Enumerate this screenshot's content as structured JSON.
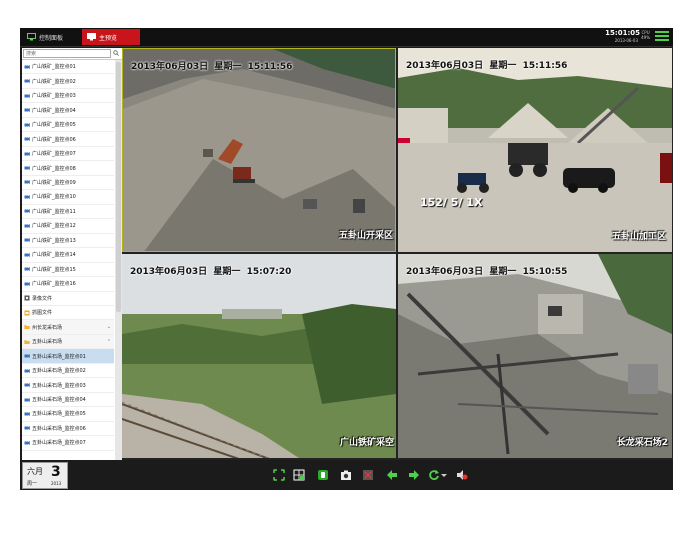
{
  "topbar": {
    "tab_control": "控制面板",
    "tab_preview": "主预览",
    "clock_time": "15:01:05",
    "clock_date": "2013-06-03",
    "cpu_label": "CPU",
    "cpu_value": "49%"
  },
  "sidebar": {
    "search_placeholder": "搜索",
    "items": [
      {
        "label": "广山铁矿_监控点01",
        "kind": "camera"
      },
      {
        "label": "广山铁矿_监控点02",
        "kind": "camera"
      },
      {
        "label": "广山铁矿_监控点03",
        "kind": "camera"
      },
      {
        "label": "广山铁矿_监控点04",
        "kind": "camera"
      },
      {
        "label": "广山铁矿_监控点05",
        "kind": "camera"
      },
      {
        "label": "广山铁矿_监控点06",
        "kind": "camera"
      },
      {
        "label": "广山铁矿_监控点07",
        "kind": "camera"
      },
      {
        "label": "广山铁矿_监控点08",
        "kind": "camera"
      },
      {
        "label": "广山铁矿_监控点09",
        "kind": "camera"
      },
      {
        "label": "广山铁矿_监控点10",
        "kind": "camera"
      },
      {
        "label": "广山铁矿_监控点11",
        "kind": "camera"
      },
      {
        "label": "广山铁矿_监控点12",
        "kind": "camera"
      },
      {
        "label": "广山铁矿_监控点13",
        "kind": "camera"
      },
      {
        "label": "广山铁矿_监控点14",
        "kind": "camera"
      },
      {
        "label": "广山铁矿_监控点15",
        "kind": "camera"
      },
      {
        "label": "广山铁矿_监控点16",
        "kind": "camera"
      },
      {
        "label": "录像文件",
        "kind": "file"
      },
      {
        "label": "抓图文件",
        "kind": "image"
      },
      {
        "label": "州长龙采石场",
        "kind": "group",
        "chev": "⌄"
      },
      {
        "label": "五卦山采石场",
        "kind": "group",
        "chev": "⌃"
      },
      {
        "label": "五卦山采石场_监控点01",
        "kind": "camera",
        "selected": true
      },
      {
        "label": "五卦山采石场_监控点02",
        "kind": "camera"
      },
      {
        "label": "五卦山采石场_监控点03",
        "kind": "camera"
      },
      {
        "label": "五卦山采石场_监控点04",
        "kind": "camera"
      },
      {
        "label": "五卦山采石场_监控点05",
        "kind": "camera"
      },
      {
        "label": "五卦山采石场_监控点06",
        "kind": "camera"
      },
      {
        "label": "五卦山采石场_监控点07",
        "kind": "camera"
      }
    ]
  },
  "date": {
    "month": "六月",
    "day": "3",
    "weekday": "周一",
    "year": "2013"
  },
  "cameras": [
    {
      "timestamp": "2013年06月03日  星期一  15:11:56",
      "caption": "五卦山开采区"
    },
    {
      "timestamp": "2013年06月03日  星期一  15:11:56",
      "caption": "五卦山加工区",
      "overlay": "152/ 5/ 1X"
    },
    {
      "timestamp": "2013年06月03日  星期一  15:07:20",
      "caption": "广山铁矿采空"
    },
    {
      "timestamp": "2013年06月03日  星期一  15:10:55",
      "caption": "长龙采石场2"
    }
  ],
  "colors": {
    "accent_red": "#c8151b",
    "accent_green": "#4fd04a",
    "active_border": "#b5b51f"
  },
  "toolbar_icons": [
    "fullscreen-icon",
    "layout-icon",
    "record-icon",
    "snapshot-icon",
    "close-preview-icon",
    "previous-icon",
    "next-icon",
    "refresh-icon",
    "mute-icon"
  ]
}
